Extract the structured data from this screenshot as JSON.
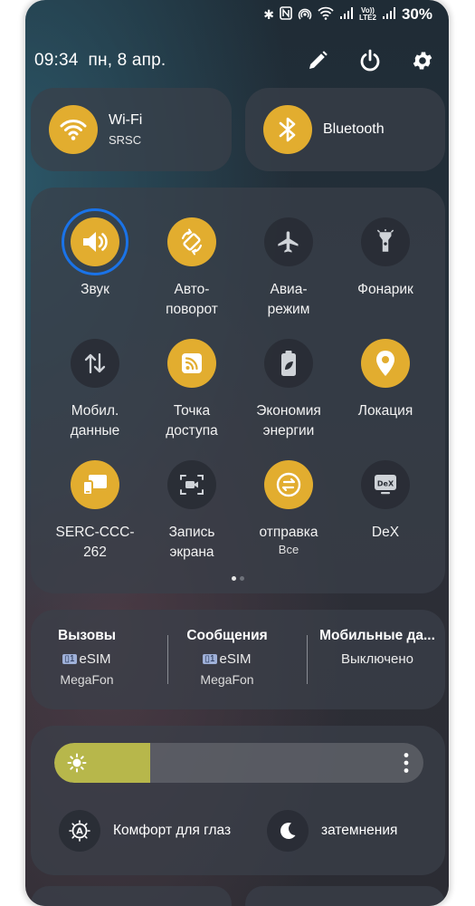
{
  "status": {
    "battery": "30%",
    "network": "LTE2",
    "volte": "Vo))"
  },
  "header": {
    "time": "09:34",
    "date": "пн, 8 апр."
  },
  "wifi": {
    "label": "Wi-Fi",
    "network": "SRSC"
  },
  "bluetooth": {
    "label": "Bluetooth"
  },
  "tiles": [
    {
      "id": "sound",
      "label": "Звук",
      "state": "on",
      "icon": "speaker-icon"
    },
    {
      "id": "autorotate",
      "label": "Авто-\nповорот",
      "state": "on",
      "icon": "rotate-icon"
    },
    {
      "id": "airplane",
      "label": "Авиа-\nрежим",
      "state": "off",
      "icon": "airplane-icon"
    },
    {
      "id": "flashlight",
      "label": "Фонарик",
      "state": "off",
      "icon": "flashlight-icon"
    },
    {
      "id": "mobile-data",
      "label": "Мобил.\nданные",
      "state": "off",
      "icon": "data-arrows-icon"
    },
    {
      "id": "hotspot",
      "label": "Точка\nдоступа",
      "state": "on",
      "icon": "hotspot-icon"
    },
    {
      "id": "power-saving",
      "label": "Экономия\nэнергии",
      "state": "off",
      "icon": "battery-leaf-icon"
    },
    {
      "id": "location",
      "label": "Локация",
      "state": "on",
      "icon": "location-pin-icon"
    },
    {
      "id": "serc",
      "label": "SERC-CCC-\n262",
      "state": "on",
      "icon": "devices-icon"
    },
    {
      "id": "screen-record",
      "label": "Запись\nэкрана",
      "state": "off",
      "icon": "screen-record-icon"
    },
    {
      "id": "sharing",
      "label": "отправка",
      "sub": "Все",
      "state": "on",
      "icon": "quick-share-icon"
    },
    {
      "id": "dex",
      "label": "DeX",
      "state": "off",
      "icon": "dex-icon"
    }
  ],
  "sim": [
    {
      "title": "Вызовы",
      "sim": "eSIM",
      "operator": "MegaFon"
    },
    {
      "title": "Сообщения",
      "sim": "eSIM",
      "operator": "MegaFon"
    },
    {
      "title": "Мобильные да...",
      "status": "Выключено"
    }
  ],
  "brightness": {
    "level": 0.26
  },
  "modes": {
    "eye_comfort": "Комфорт для глаз",
    "dark": "затемнения"
  },
  "colors": {
    "accent": "#e2ad2f",
    "focus_ring": "#1a73e8",
    "slider_fill": "#b7b74b"
  },
  "pager": {
    "count": 2,
    "active": 0
  }
}
